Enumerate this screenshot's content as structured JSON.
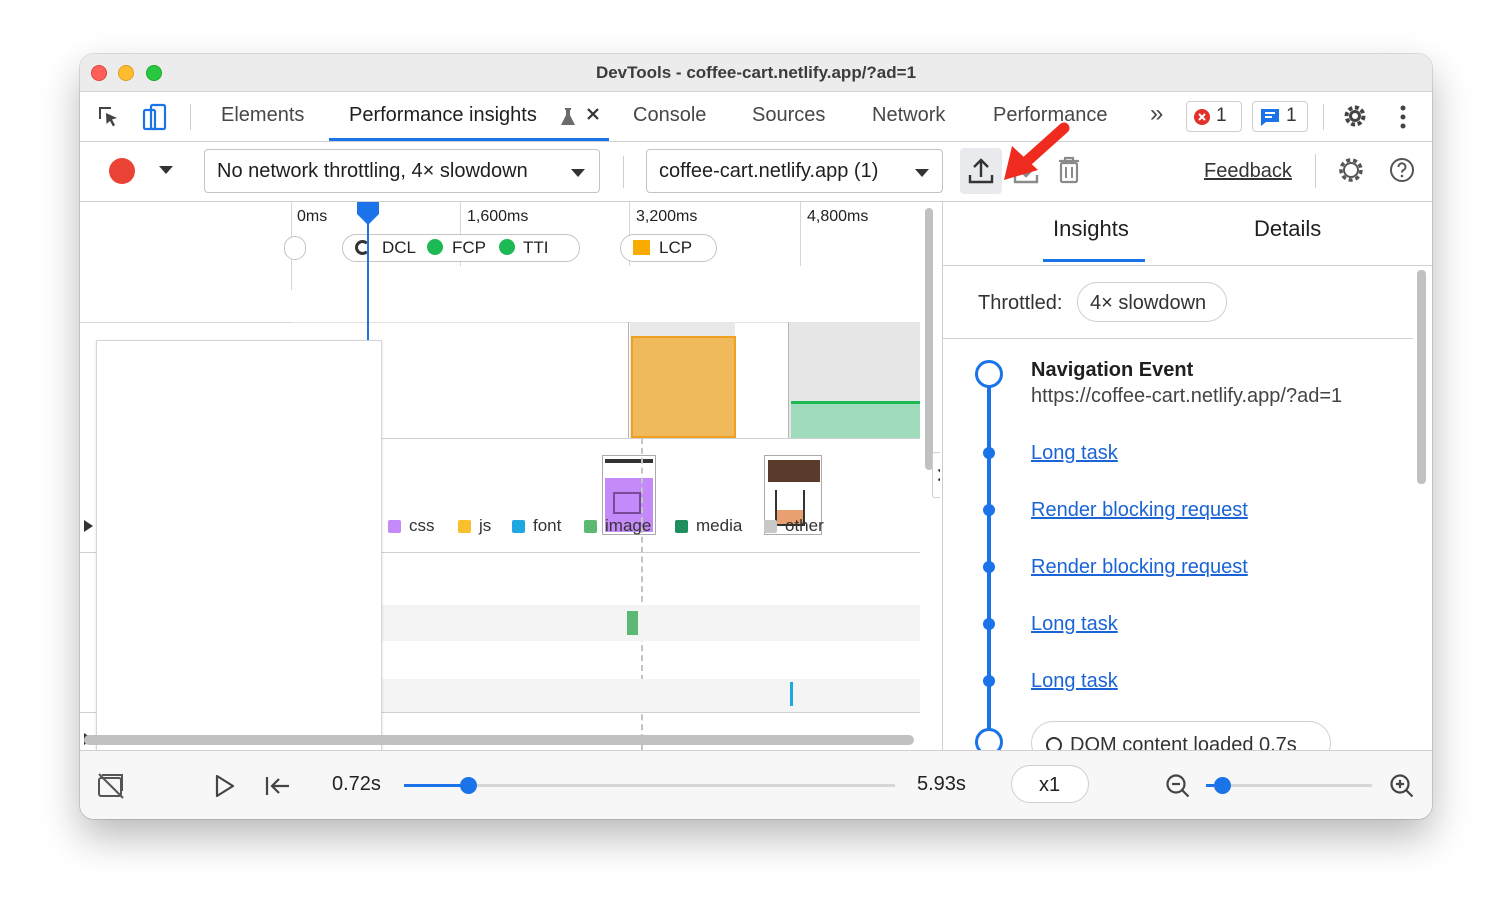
{
  "window": {
    "title": "DevTools - coffee-cart.netlify.app/?ad=1"
  },
  "tabs": {
    "elements": "Elements",
    "performance_insights": "Performance insights",
    "console": "Console",
    "sources": "Sources",
    "network": "Network",
    "performance": "Performance",
    "more": "»",
    "errors_count": "1",
    "messages_count": "1"
  },
  "toolbar": {
    "throttling_value": "No network throttling, 4× slowdown",
    "recording_value": "coffee-cart.netlify.app (1)",
    "feedback_label": "Feedback"
  },
  "timeline": {
    "ruler": [
      "0ms",
      "1,600ms",
      "3,200ms",
      "4,800ms"
    ],
    "markers": {
      "dcl": "DCL",
      "fcp": "FCP",
      "tti": "TTI",
      "lcp": "LCP"
    },
    "legend": [
      {
        "label": "css",
        "color": "#c58af9"
      },
      {
        "label": "js",
        "color": "#f9c02c"
      },
      {
        "label": "font",
        "color": "#1ea7e0"
      },
      {
        "label": "image",
        "color": "#5bb974"
      },
      {
        "label": "media",
        "color": "#1e8e5e"
      },
      {
        "label": "other",
        "color": "#c8c8c8"
      }
    ]
  },
  "sidebar": {
    "tab_insights": "Insights",
    "tab_details": "Details",
    "throttled_label": "Throttled:",
    "throttled_value": "4× slowdown",
    "nav_event_title": "Navigation Event",
    "nav_event_url": "https://coffee-cart.netlify.app/?ad=1",
    "items": [
      "Long task",
      "Render blocking request",
      "Render blocking request",
      "Long task",
      "Long task"
    ],
    "dom_loaded": "DOM content loaded 0.7s"
  },
  "playback": {
    "current_time": "0.72s",
    "end_time": "5.93s",
    "speed": "x1",
    "progress": 0.13,
    "zoom_level": 0.05
  },
  "colors": {
    "accent": "#1a73e8",
    "record_red": "#ea4335",
    "lcp_orange": "#f0b95c",
    "green": "#1db954"
  }
}
